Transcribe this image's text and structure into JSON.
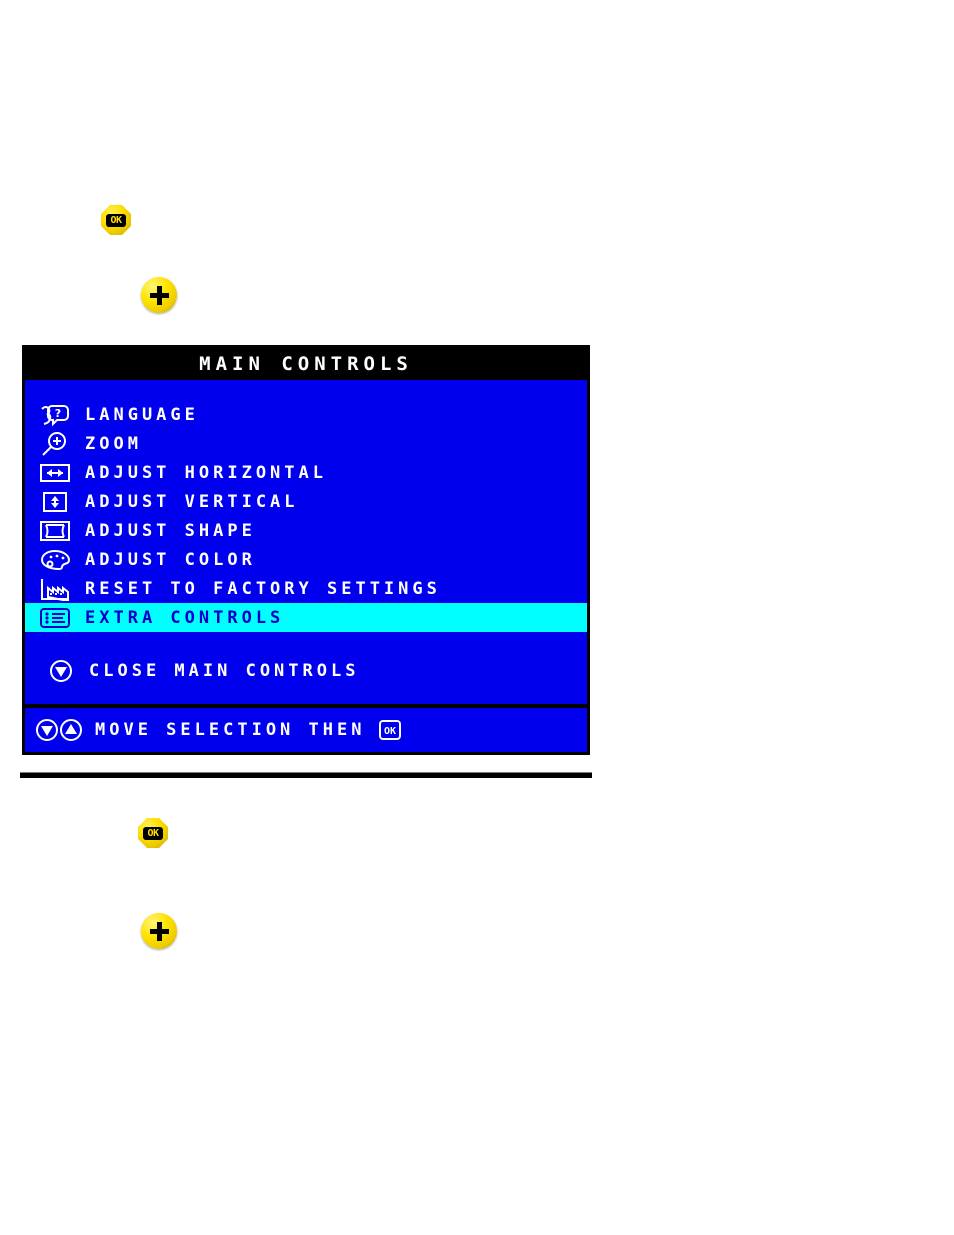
{
  "hardware_buttons": [
    {
      "name": "ok-button-top",
      "icon": "ok-button-icon",
      "label": "OK"
    },
    {
      "name": "plus-button-top",
      "icon": "plus-button-icon",
      "label": "+"
    },
    {
      "name": "ok-button-bottom",
      "icon": "ok-button-icon",
      "label": "OK"
    },
    {
      "name": "plus-button-bottom",
      "icon": "plus-button-icon",
      "label": "+"
    }
  ],
  "osd": {
    "title": "MAIN CONTROLS",
    "items": [
      {
        "icon": "language-face-icon",
        "label": "LANGUAGE",
        "selected": false
      },
      {
        "icon": "zoom-magnifier-icon",
        "label": "ZOOM",
        "selected": false
      },
      {
        "icon": "adjust-horizontal-icon",
        "label": "ADJUST HORIZONTAL",
        "selected": false
      },
      {
        "icon": "adjust-vertical-icon",
        "label": "ADJUST VERTICAL",
        "selected": false
      },
      {
        "icon": "adjust-shape-icon",
        "label": "ADJUST SHAPE",
        "selected": false
      },
      {
        "icon": "adjust-color-icon",
        "label": "ADJUST COLOR",
        "selected": false
      },
      {
        "icon": "factory-reset-icon",
        "label": "RESET TO FACTORY SETTINGS",
        "selected": false
      },
      {
        "icon": "extra-controls-icon",
        "label": "EXTRA CONTROLS",
        "selected": true
      }
    ],
    "close_item": {
      "icon": "down-arrow-circle-icon",
      "label": "CLOSE MAIN CONTROLS"
    },
    "footer": {
      "icons": [
        "down-arrow-circle-icon",
        "up-arrow-circle-icon"
      ],
      "label": "MOVE SELECTION THEN",
      "ok_icon": "ok-box-icon",
      "ok_text": "OK"
    },
    "colors": {
      "background": "#0000ee",
      "title_bar": "#000000",
      "text": "#ffffff",
      "highlight_background": "#00ffff",
      "highlight_text": "#0000cc",
      "button_yellow": "#ffe000"
    }
  }
}
